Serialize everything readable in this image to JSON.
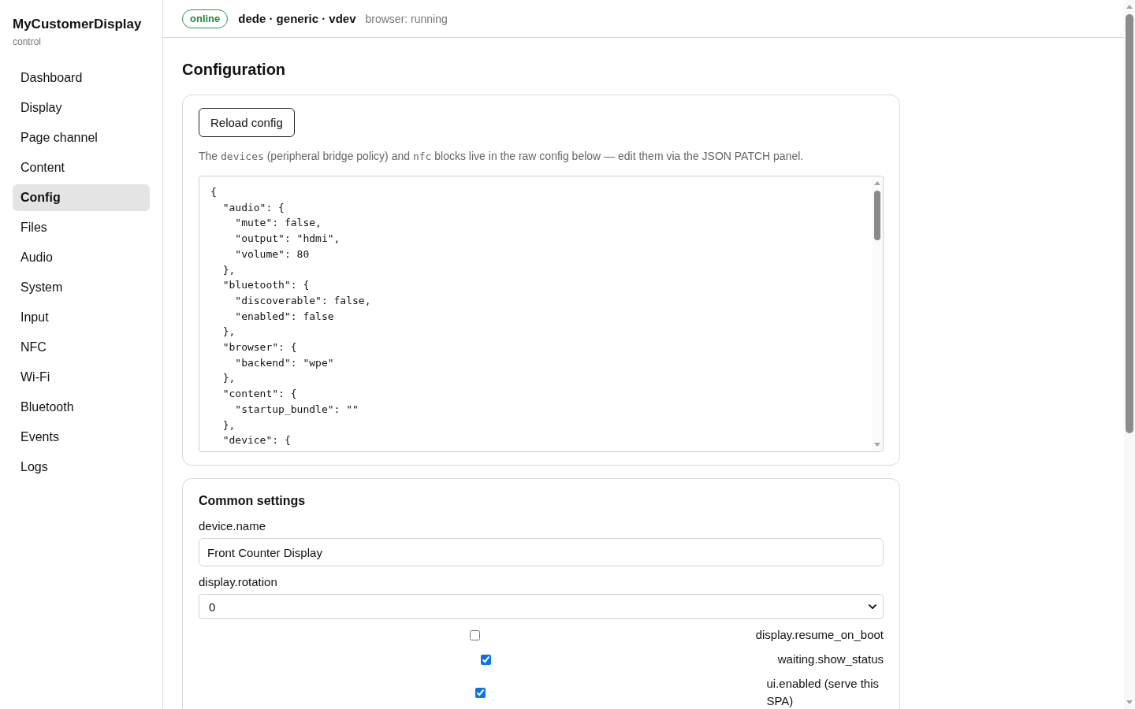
{
  "sidebar": {
    "brand": "MyCustomerDisplay",
    "subtitle": "control",
    "items": [
      {
        "label": "Dashboard",
        "selected": false
      },
      {
        "label": "Display",
        "selected": false
      },
      {
        "label": "Page channel",
        "selected": false
      },
      {
        "label": "Content",
        "selected": false
      },
      {
        "label": "Config",
        "selected": true
      },
      {
        "label": "Files",
        "selected": false
      },
      {
        "label": "Audio",
        "selected": false
      },
      {
        "label": "System",
        "selected": false
      },
      {
        "label": "Input",
        "selected": false
      },
      {
        "label": "NFC",
        "selected": false
      },
      {
        "label": "Wi-Fi",
        "selected": false
      },
      {
        "label": "Bluetooth",
        "selected": false
      },
      {
        "label": "Events",
        "selected": false
      },
      {
        "label": "Logs",
        "selected": false
      }
    ]
  },
  "top_bar": {
    "status_badge": "online",
    "device": "dede · generic · vdev",
    "browser_status": "browser: running"
  },
  "page_title": "Configuration",
  "config_card": {
    "reload_button": "Reload config",
    "note": [
      {
        "kind": "text",
        "text": "The "
      },
      {
        "kind": "code",
        "text": "devices"
      },
      {
        "kind": "text",
        "text": " (peripheral bridge policy) and "
      },
      {
        "kind": "code",
        "text": "nfc"
      },
      {
        "kind": "text",
        "text": " blocks live in the raw config below — edit them via the JSON PATCH panel."
      }
    ],
    "raw_config": "{\n  \"audio\": {\n    \"mute\": false,\n    \"output\": \"hdmi\",\n    \"volume\": 80\n  },\n  \"bluetooth\": {\n    \"discoverable\": false,\n    \"enabled\": false\n  },\n  \"browser\": {\n    \"backend\": \"wpe\"\n  },\n  \"content\": {\n    \"startup_bundle\": \"\"\n  },\n  \"device\": {"
  },
  "common_settings": {
    "title": "Common settings",
    "fields": [
      {
        "kind": "text",
        "label": "device.name",
        "value": "Front Counter Display"
      },
      {
        "kind": "select",
        "label": "display.rotation",
        "value": "0"
      },
      {
        "kind": "checkbox",
        "label": "display.resume_on_boot",
        "checked": false
      },
      {
        "kind": "checkbox",
        "label": "waiting.show_status",
        "checked": true
      },
      {
        "kind": "checkbox",
        "label": "ui.enabled (serve this SPA)",
        "checked": true
      }
    ]
  }
}
